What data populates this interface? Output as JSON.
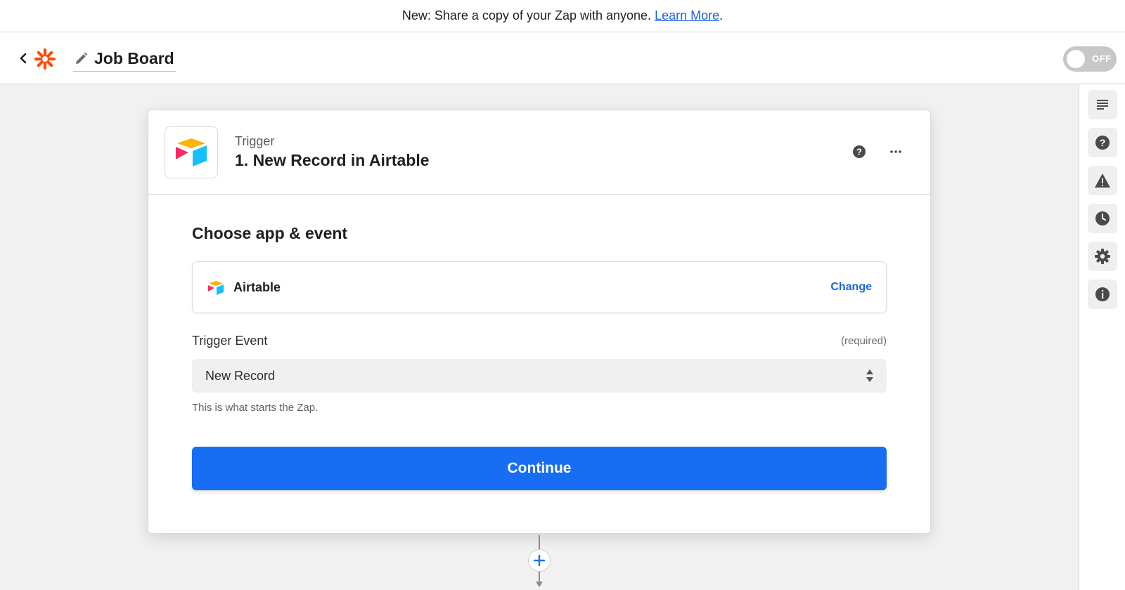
{
  "banner": {
    "text": "New: Share a copy of your Zap with anyone.",
    "link_label": "Learn More",
    "suffix": "."
  },
  "header": {
    "zap_name": "Job Board",
    "toggle_label": "OFF",
    "logo_icon": "zapier-asterisk-icon",
    "brand_color": "#ff4a00"
  },
  "step": {
    "kicker": "Trigger",
    "title": "1. New Record in Airtable",
    "app_icon": "airtable-logo-icon"
  },
  "form": {
    "section_title": "Choose app & event",
    "app_name": "Airtable",
    "change_label": "Change",
    "trigger_event_label": "Trigger Event",
    "required_label": "(required)",
    "trigger_event_value": "New Record",
    "help_text": "This is what starts the Zap.",
    "continue_label": "Continue"
  },
  "right_rail": [
    {
      "icon": "outline-icon"
    },
    {
      "icon": "help-icon"
    },
    {
      "icon": "warning-icon"
    },
    {
      "icon": "history-clock-icon"
    },
    {
      "icon": "settings-gear-icon"
    },
    {
      "icon": "info-icon"
    }
  ],
  "colors": {
    "accent": "#176ef2",
    "link": "#1a63e6",
    "toggle_off": "#c7c7c7"
  }
}
